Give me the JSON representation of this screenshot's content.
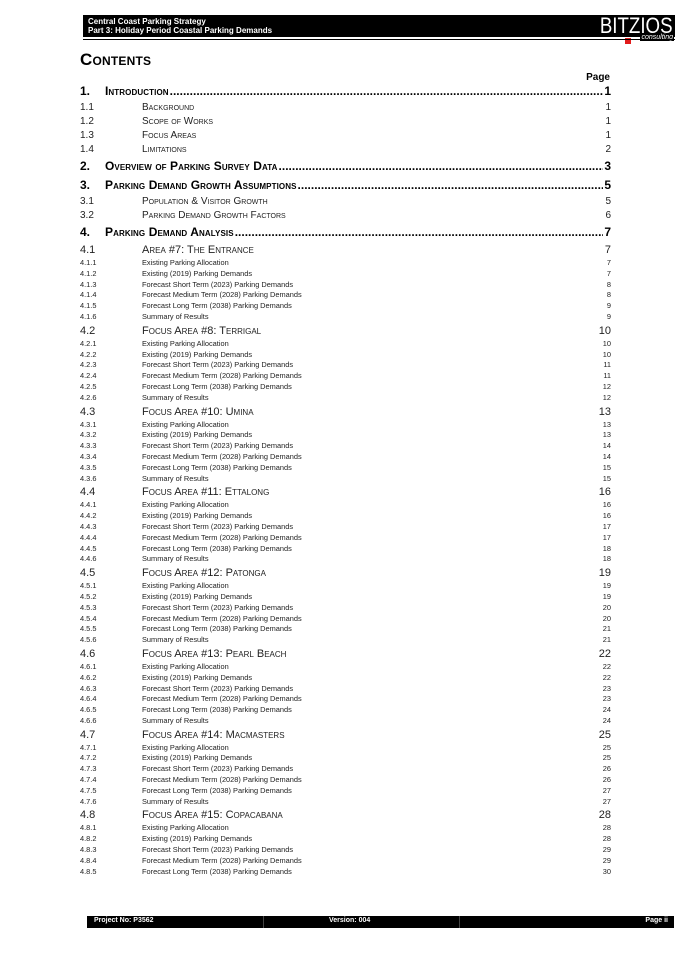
{
  "header": {
    "line1": "Central Coast Parking Strategy",
    "line2": "Part 3: Holiday Period Coastal Parking Demands",
    "logo_text": "BITZIOS",
    "logo_sub": "consulting"
  },
  "contents": {
    "title": "Contents",
    "page_label": "Page"
  },
  "toc": [
    {
      "level": 1,
      "num": "1.",
      "title": "Introduction",
      "page": "1"
    },
    {
      "level": 2,
      "num": "1.1",
      "title": "Background",
      "page": "1"
    },
    {
      "level": 2,
      "num": "1.2",
      "title": "Scope of Works",
      "page": "1"
    },
    {
      "level": 2,
      "num": "1.3",
      "title": "Focus Areas",
      "page": "1"
    },
    {
      "level": 2,
      "num": "1.4",
      "title": "Limitations",
      "page": "2"
    },
    {
      "level": 1,
      "num": "2.",
      "title": "Overview of Parking Survey Data",
      "page": "3"
    },
    {
      "level": 1,
      "num": "3.",
      "title": "Parking Demand Growth Assumptions",
      "page": "5"
    },
    {
      "level": 2,
      "num": "3.1",
      "title": "Population & Visitor Growth",
      "page": "5"
    },
    {
      "level": 2,
      "num": "3.2",
      "title": "Parking Demand Growth Factors",
      "page": "6"
    },
    {
      "level": 1,
      "num": "4.",
      "title": "Parking Demand Analysis",
      "page": "7"
    },
    {
      "level": 2,
      "num": "4.1",
      "title": "Area #7: The Entrance",
      "page": "7",
      "big": true
    },
    {
      "level": 3,
      "num": "4.1.1",
      "title": "Existing Parking Allocation",
      "page": "7"
    },
    {
      "level": 3,
      "num": "4.1.2",
      "title": "Existing (2019) Parking Demands",
      "page": "7"
    },
    {
      "level": 3,
      "num": "4.1.3",
      "title": "Forecast Short Term (2023) Parking Demands",
      "page": "8"
    },
    {
      "level": 3,
      "num": "4.1.4",
      "title": "Forecast Medium Term (2028) Parking Demands",
      "page": "8"
    },
    {
      "level": 3,
      "num": "4.1.5",
      "title": "Forecast Long Term (2038) Parking Demands",
      "page": "9"
    },
    {
      "level": 3,
      "num": "4.1.6",
      "title": "Summary of Results",
      "page": "9"
    },
    {
      "level": 2,
      "num": "4.2",
      "title": "Focus Area #8: Terrigal",
      "page": "10",
      "big": true
    },
    {
      "level": 3,
      "num": "4.2.1",
      "title": "Existing Parking Allocation",
      "page": "10"
    },
    {
      "level": 3,
      "num": "4.2.2",
      "title": "Existing (2019) Parking Demands",
      "page": "10"
    },
    {
      "level": 3,
      "num": "4.2.3",
      "title": "Forecast Short Term (2023) Parking Demands",
      "page": "11"
    },
    {
      "level": 3,
      "num": "4.2.4",
      "title": "Forecast Medium Term (2028) Parking Demands",
      "page": "11"
    },
    {
      "level": 3,
      "num": "4.2.5",
      "title": "Forecast Long Term (2038) Parking Demands",
      "page": "12"
    },
    {
      "level": 3,
      "num": "4.2.6",
      "title": "Summary of Results",
      "page": "12"
    },
    {
      "level": 2,
      "num": "4.3",
      "title": "Focus Area #10: Umina",
      "page": "13",
      "big": true
    },
    {
      "level": 3,
      "num": "4.3.1",
      "title": "Existing Parking Allocation",
      "page": "13"
    },
    {
      "level": 3,
      "num": "4.3.2",
      "title": "Existing (2019) Parking Demands",
      "page": "13"
    },
    {
      "level": 3,
      "num": "4.3.3",
      "title": "Forecast Short Term (2023) Parking Demands",
      "page": "14"
    },
    {
      "level": 3,
      "num": "4.3.4",
      "title": "Forecast Medium Term (2028) Parking Demands",
      "page": "14"
    },
    {
      "level": 3,
      "num": "4.3.5",
      "title": "Forecast Long Term (2038) Parking Demands",
      "page": "15"
    },
    {
      "level": 3,
      "num": "4.3.6",
      "title": "Summary of Results",
      "page": "15"
    },
    {
      "level": 2,
      "num": "4.4",
      "title": "Focus Area #11: Ettalong",
      "page": "16",
      "big": true
    },
    {
      "level": 3,
      "num": "4.4.1",
      "title": "Existing Parking Allocation",
      "page": "16"
    },
    {
      "level": 3,
      "num": "4.4.2",
      "title": "Existing (2019) Parking Demands",
      "page": "16"
    },
    {
      "level": 3,
      "num": "4.4.3",
      "title": "Forecast Short Term (2023) Parking Demands",
      "page": "17"
    },
    {
      "level": 3,
      "num": "4.4.4",
      "title": "Forecast Medium Term (2028) Parking Demands",
      "page": "17"
    },
    {
      "level": 3,
      "num": "4.4.5",
      "title": "Forecast Long Term (2038) Parking Demands",
      "page": "18"
    },
    {
      "level": 3,
      "num": "4.4.6",
      "title": "Summary of Results",
      "page": "18"
    },
    {
      "level": 2,
      "num": "4.5",
      "title": "Focus Area #12: Patonga",
      "page": "19",
      "big": true
    },
    {
      "level": 3,
      "num": "4.5.1",
      "title": "Existing Parking Allocation",
      "page": "19"
    },
    {
      "level": 3,
      "num": "4.5.2",
      "title": "Existing (2019) Parking Demands",
      "page": "19"
    },
    {
      "level": 3,
      "num": "4.5.3",
      "title": "Forecast Short Term (2023) Parking Demands",
      "page": "20"
    },
    {
      "level": 3,
      "num": "4.5.4",
      "title": "Forecast Medium Term (2028) Parking Demands",
      "page": "20"
    },
    {
      "level": 3,
      "num": "4.5.5",
      "title": "Forecast Long Term (2038) Parking Demands",
      "page": "21"
    },
    {
      "level": 3,
      "num": "4.5.6",
      "title": "Summary of Results",
      "page": "21"
    },
    {
      "level": 2,
      "num": "4.6",
      "title": "Focus Area #13: Pearl Beach",
      "page": "22",
      "big": true
    },
    {
      "level": 3,
      "num": "4.6.1",
      "title": "Existing Parking Allocation",
      "page": "22"
    },
    {
      "level": 3,
      "num": "4.6.2",
      "title": "Existing (2019) Parking Demands",
      "page": "22"
    },
    {
      "level": 3,
      "num": "4.6.3",
      "title": "Forecast Short Term (2023) Parking Demands",
      "page": "23"
    },
    {
      "level": 3,
      "num": "4.6.4",
      "title": "Forecast Medium Term (2028) Parking Demands",
      "page": "23"
    },
    {
      "level": 3,
      "num": "4.6.5",
      "title": "Forecast Long Term (2038) Parking Demands",
      "page": "24"
    },
    {
      "level": 3,
      "num": "4.6.6",
      "title": "Summary of Results",
      "page": "24"
    },
    {
      "level": 2,
      "num": "4.7",
      "title": "Focus Area #14: Macmasters",
      "page": "25",
      "big": true
    },
    {
      "level": 3,
      "num": "4.7.1",
      "title": "Existing Parking Allocation",
      "page": "25"
    },
    {
      "level": 3,
      "num": "4.7.2",
      "title": "Existing (2019) Parking Demands",
      "page": "25"
    },
    {
      "level": 3,
      "num": "4.7.3",
      "title": "Forecast Short Term (2023) Parking Demands",
      "page": "26"
    },
    {
      "level": 3,
      "num": "4.7.4",
      "title": "Forecast Medium Term (2028) Parking Demands",
      "page": "26"
    },
    {
      "level": 3,
      "num": "4.7.5",
      "title": "Forecast Long Term (2038) Parking Demands",
      "page": "27"
    },
    {
      "level": 3,
      "num": "4.7.6",
      "title": "Summary of Results",
      "page": "27"
    },
    {
      "level": 2,
      "num": "4.8",
      "title": "Focus Area #15: Copacabana",
      "page": "28",
      "big": true
    },
    {
      "level": 3,
      "num": "4.8.1",
      "title": "Existing Parking Allocation",
      "page": "28"
    },
    {
      "level": 3,
      "num": "4.8.2",
      "title": "Existing (2019) Parking Demands",
      "page": "28"
    },
    {
      "level": 3,
      "num": "4.8.3",
      "title": "Forecast Short Term (2023) Parking Demands",
      "page": "29"
    },
    {
      "level": 3,
      "num": "4.8.4",
      "title": "Forecast Medium Term (2028) Parking Demands",
      "page": "29"
    },
    {
      "level": 3,
      "num": "4.8.5",
      "title": "Forecast Long Term (2038) Parking Demands",
      "page": "30"
    }
  ],
  "footer": {
    "project": "Project No: P3562",
    "version": "Version: 004",
    "page": "Page ii"
  }
}
